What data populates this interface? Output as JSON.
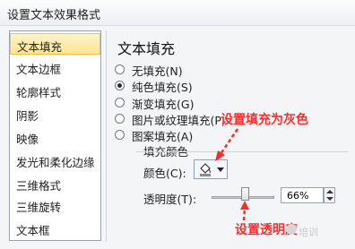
{
  "window": {
    "title": "设置文本效果格式"
  },
  "sidebar": {
    "items": [
      {
        "label": "文本填充",
        "selected": true
      },
      {
        "label": "文本边框"
      },
      {
        "label": "轮廓样式"
      },
      {
        "label": "阴影"
      },
      {
        "label": "映像"
      },
      {
        "label": "发光和柔化边缘"
      },
      {
        "label": "三维格式"
      },
      {
        "label": "三维旋转"
      },
      {
        "label": "文本框"
      }
    ]
  },
  "main": {
    "heading": "文本填充",
    "options": [
      {
        "label": "无填充(N)",
        "checked": false
      },
      {
        "label": "纯色填充(S)",
        "checked": true
      },
      {
        "label": "渐变填充(G)",
        "checked": false
      },
      {
        "label": "图片或纹理填充(P)",
        "checked": false
      },
      {
        "label": "图案填充(A)",
        "checked": false
      }
    ],
    "fill_color_group": "填充颜色",
    "color_label": "颜色(C):",
    "transparency_label": "透明度(T):",
    "transparency_value": "66%",
    "transparency_fraction": 0.66
  },
  "annotations": {
    "set_gray": "设置填充为灰色",
    "set_transparency": "设置透明度",
    "watermark": "培训",
    "color": "#ff2a2a"
  }
}
